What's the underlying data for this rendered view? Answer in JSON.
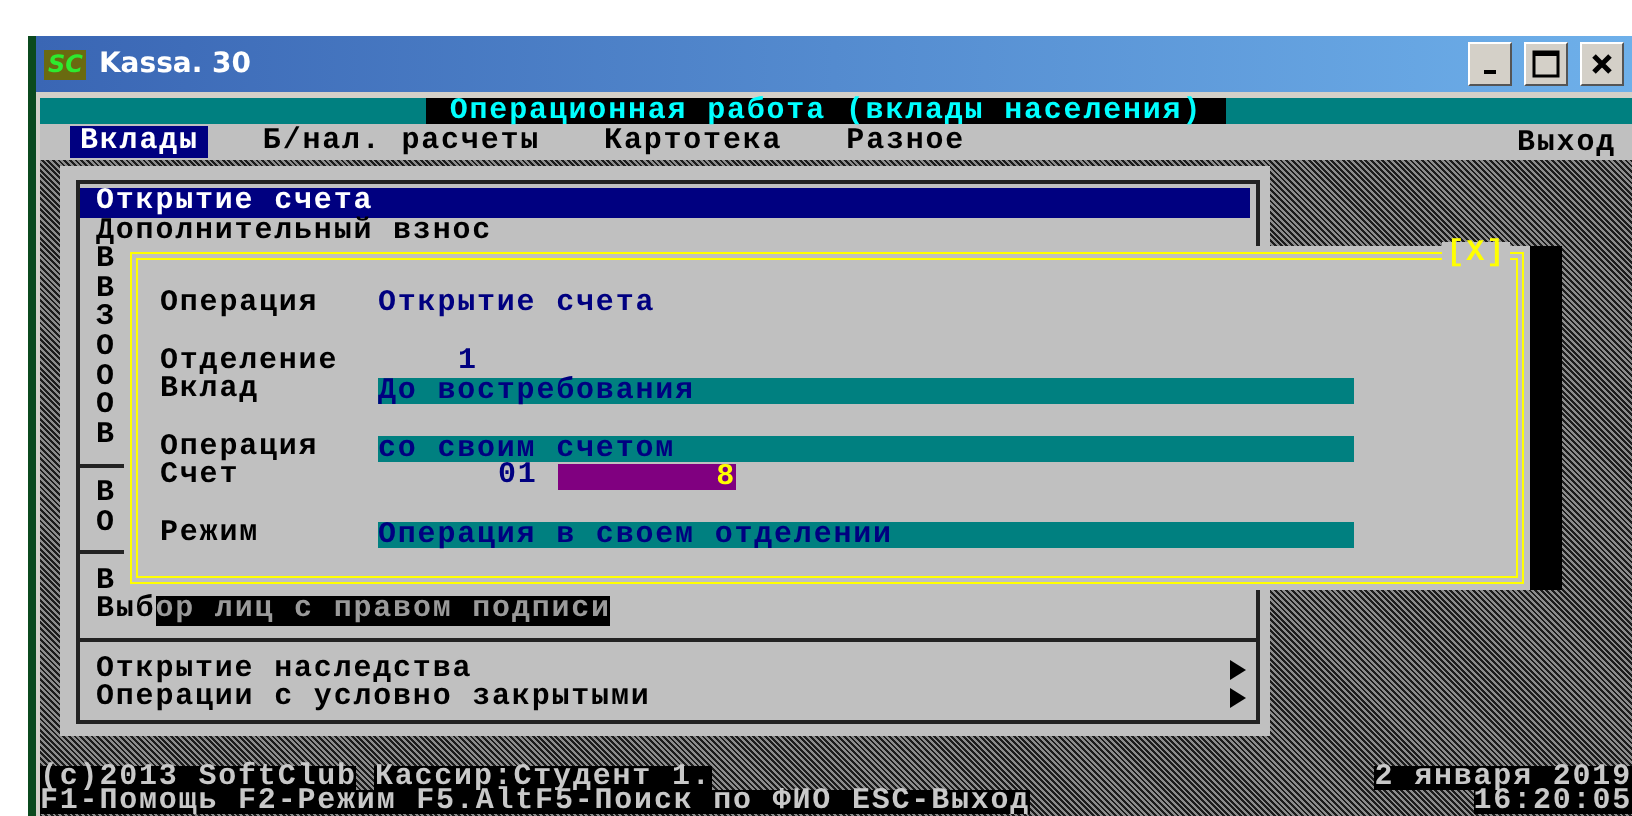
{
  "window": {
    "logo": "SC",
    "title": "Kassa. 30"
  },
  "header_title": "Операционная работа (вклады населения)",
  "menu_bar": {
    "items": [
      {
        "label": "Вклады",
        "selected": true
      },
      {
        "label": "Б/нал. расчеты",
        "selected": false
      },
      {
        "label": "Картотека",
        "selected": false
      },
      {
        "label": "Разное",
        "selected": false
      }
    ],
    "exit": "Выход"
  },
  "menu_groups": [
    [
      {
        "label": "Открытие счета",
        "selected": true,
        "submenu": false
      },
      {
        "label": "Дополнительный взнос",
        "selected": false,
        "submenu": false
      },
      {
        "label": "В",
        "selected": false
      },
      {
        "label": "В",
        "selected": false
      },
      {
        "label": "З",
        "selected": false
      },
      {
        "label": "О",
        "selected": false
      },
      {
        "label": "О",
        "selected": false
      },
      {
        "label": "О",
        "selected": false
      },
      {
        "label": "В",
        "selected": false
      }
    ],
    [
      {
        "label": "В",
        "selected": false
      },
      {
        "label": "О",
        "selected": false
      }
    ],
    [
      {
        "label": "В",
        "selected": false
      },
      {
        "label": "Выбор лиц с правом подписи",
        "selected": false,
        "shadowed": true
      }
    ],
    [
      {
        "label": "Открытие наследства",
        "selected": false,
        "submenu": true
      },
      {
        "label": "Операции с условно закрытыми",
        "selected": false,
        "submenu": true
      }
    ]
  ],
  "dialog": {
    "close": "[X]",
    "groups": [
      [
        {
          "label": "Операция",
          "value": "Открытие счета",
          "kind": "text"
        }
      ],
      [
        {
          "label": "Отделение",
          "value": "1",
          "kind": "number"
        },
        {
          "label": "Вклад",
          "value": "До востребования",
          "kind": "field"
        }
      ],
      [
        {
          "label": "Операция",
          "value": "со своим счетом",
          "kind": "field"
        },
        {
          "label": "Счет",
          "prefix": "01",
          "value": "8",
          "kind": "account"
        }
      ],
      [
        {
          "label": "Режим",
          "value": "Операция в своем отделении",
          "kind": "field"
        }
      ]
    ]
  },
  "status_bar": {
    "copyright": "(c)2013 SoftClub",
    "cashier": "Кассир:Студент 1.",
    "date": "2 января 2019",
    "hints": "F1-Помощь F2-Режим F5.AltF5-Поиск по ФИО ESC-Выход",
    "time": "16:20:05"
  }
}
